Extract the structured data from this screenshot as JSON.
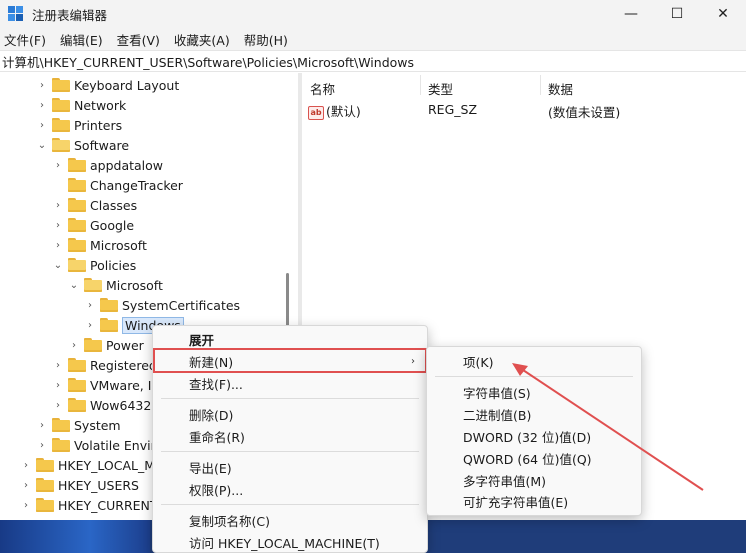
{
  "window": {
    "title": "注册表编辑器"
  },
  "controls": {
    "minimize": "—",
    "maximize": "☐",
    "close": "✕"
  },
  "menu": [
    "文件(F)",
    "编辑(E)",
    "查看(V)",
    "收藏夹(A)",
    "帮助(H)"
  ],
  "address": "计算机\\HKEY_CURRENT_USER\\Software\\Policies\\Microsoft\\Windows",
  "tree": [
    {
      "label": "Keyboard Layout",
      "chev": "›"
    },
    {
      "label": "Network",
      "chev": "›"
    },
    {
      "label": "Printers",
      "chev": "›"
    },
    {
      "label": "Software",
      "chev": "⌄"
    },
    {
      "label": "appdatalow",
      "chev": "›"
    },
    {
      "label": "ChangeTracker",
      "chev": ""
    },
    {
      "label": "Classes",
      "chev": "›"
    },
    {
      "label": "Google",
      "chev": "›"
    },
    {
      "label": "Microsoft",
      "chev": "›"
    },
    {
      "label": "Policies",
      "chev": "⌄"
    },
    {
      "label": "Microsoft",
      "chev": "⌄"
    },
    {
      "label": "SystemCertificates",
      "chev": "›"
    },
    {
      "label": "Windows",
      "chev": "›"
    },
    {
      "label": "Power",
      "chev": "›"
    },
    {
      "label": "Registered",
      "chev": "›"
    },
    {
      "label": "VMware, In",
      "chev": "›"
    },
    {
      "label": "Wow6432N",
      "chev": "›"
    },
    {
      "label": "System",
      "chev": "›"
    },
    {
      "label": "Volatile Enviro",
      "chev": "›"
    },
    {
      "label": "HKEY_LOCAL_MA",
      "chev": "›"
    },
    {
      "label": "HKEY_USERS",
      "chev": "›"
    },
    {
      "label": "HKEY_CURRENT_",
      "chev": "›"
    }
  ],
  "list": {
    "headers": [
      "名称",
      "类型",
      "数据"
    ],
    "rows": [
      {
        "icon": "ab",
        "name": "(默认)",
        "type": "REG_SZ",
        "data": "(数值未设置)"
      }
    ]
  },
  "context_menu": {
    "items": [
      "展开",
      "新建(N)",
      "查找(F)...",
      "删除(D)",
      "重命名(R)",
      "导出(E)",
      "权限(P)...",
      "复制项名称(C)",
      "访问 HKEY_LOCAL_MACHINE(T)"
    ],
    "submenu_arrow": "›"
  },
  "submenu": {
    "items": [
      "项(K)",
      "字符串值(S)",
      "二进制值(B)",
      "DWORD (32 位)值(D)",
      "QWORD (64 位)值(Q)",
      "多字符串值(M)",
      "可扩充字符串值(E)"
    ]
  },
  "colors": {
    "highlight": "#e05050",
    "arrow": "#e05050"
  }
}
